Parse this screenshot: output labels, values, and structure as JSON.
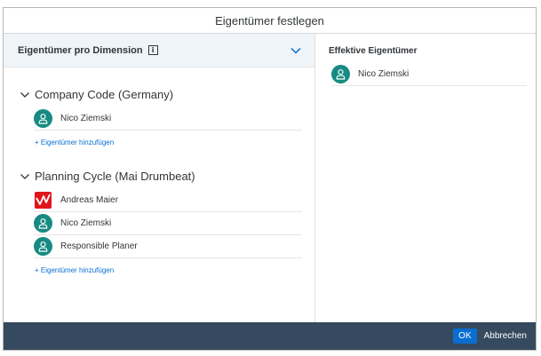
{
  "dialog": {
    "title": "Eigentümer festlegen"
  },
  "left": {
    "header_title": "Eigentümer pro Dimension",
    "groups": [
      {
        "title": "Company Code (Germany)",
        "owners": [
          {
            "name": "Nico Ziemski",
            "icon": "user-avatar-icon"
          }
        ],
        "add_label": "+ Eigentümer hinzufügen"
      },
      {
        "title": "Planning Cycle (Mai Drumbeat)",
        "owners": [
          {
            "name": "Andreas Maier",
            "icon": "app-logo-icon"
          },
          {
            "name": "Nico Ziemski",
            "icon": "user-avatar-icon"
          },
          {
            "name": "Responsible Planer",
            "icon": "user-avatar-icon"
          }
        ],
        "add_label": "+ Eigentümer hinzufügen"
      }
    ]
  },
  "right": {
    "title": "Effektive Eigentümer",
    "owners": [
      {
        "name": "Nico Ziemski",
        "icon": "user-avatar-icon"
      }
    ]
  },
  "footer": {
    "ok_label": "OK",
    "cancel_label": "Abbrechen"
  },
  "colors": {
    "avatar": "#178b83",
    "footer": "#354a5f",
    "accent": "#0a6ed1",
    "header_bg": "#eff4f9"
  }
}
